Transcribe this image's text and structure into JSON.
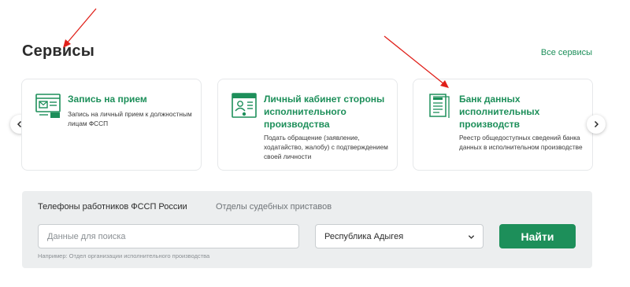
{
  "services": {
    "title": "Сервисы",
    "all_link": "Все сервисы",
    "cards": [
      {
        "icon": "appointment-icon",
        "title": "Запись на прием",
        "description": "Запись на личный прием к должностным лицам ФССП"
      },
      {
        "icon": "personal-cabinet-icon",
        "title": "Личный кабинет стороны исполнительного производства",
        "description": "Подать обращение (заявление, ходатайство, жалобу) с подтверждением своей личности"
      },
      {
        "icon": "database-document-icon",
        "title": "Банк данных исполнительных производств",
        "description": "Реестр общедоступных сведений банка данных в исполнительном производстве"
      }
    ],
    "prev_icon": "chevron-left-icon",
    "next_icon": "chevron-right-icon"
  },
  "search": {
    "tabs": [
      {
        "label": "Телефоны работников ФССП России",
        "active": true
      },
      {
        "label": "Отделы судебных приставов",
        "active": false
      }
    ],
    "input_placeholder": "Данные для поиска",
    "input_value": "",
    "region_value": "Республика Адыгея",
    "button_label": "Найти",
    "hint": "Например: Отдел организации исполнительного производства"
  },
  "colors": {
    "accent": "#1d8f5a",
    "panel_bg": "#eceeef",
    "annotation_arrow": "#e0201a"
  }
}
